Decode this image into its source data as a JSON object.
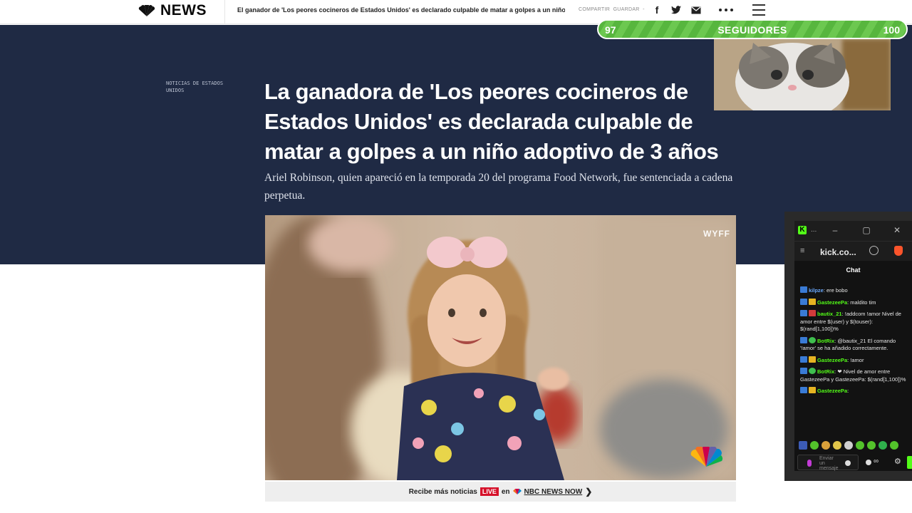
{
  "topbar": {
    "logo_text": "NEWS",
    "headline": "El ganador de 'Los peores cocineros de Estados Unidos' es declarado culpable de matar a golpes a un niño",
    "share_label": "COMPARTIR",
    "save_label": "GUARDAR",
    "more_icon": "more-dots-icon",
    "icons": [
      "facebook-icon",
      "twitter-icon",
      "email-icon",
      "menu-icon"
    ]
  },
  "article": {
    "category": "NOTICIAS DE ESTADOS UNIDOS",
    "title": "La ganadora de 'Los peores cocineros de Estados Unidos' es declarada culpable de matar a golpes a un niño adoptivo de 3 años",
    "dek": "Ariel Robinson, quien apareció en la temporada 20 del programa Food Network, fue sentenciada a cadena perpetua.",
    "video_watermark": "WYFF",
    "promo_prefix": "Recibe más noticias",
    "promo_live": "LIVE",
    "promo_en": "en",
    "promo_brand": "NBC NEWS NOW"
  },
  "overlay": {
    "followers_current": "97",
    "followers_label": "SEGUIDORES",
    "followers_goal": "100",
    "followers_progress": 0.97
  },
  "chat": {
    "url": "kick.co...",
    "header": "Chat",
    "messages": [
      {
        "user": "kilpze",
        "user_color": "#6aa9ff",
        "badges": [
          "b-blue"
        ],
        "text": ": ere bobo"
      },
      {
        "user": "GastezeePa",
        "user_color": "#53fc18",
        "badges": [
          "b-blue",
          "b-gold"
        ],
        "text": ": maldito tim"
      },
      {
        "user": "bautix_21",
        "user_color": "#53fc18",
        "badges": [
          "b-blue",
          "b-red"
        ],
        "text": ": !addcom !amor Nivel de amor entre $(user) y $(touser): $(rand[1,100])%"
      },
      {
        "user": "BotRix",
        "user_color": "#53fc18",
        "badges": [
          "b-blue",
          "b-green"
        ],
        "text": ": @bautix_21 El comando '!amor' se ha añadido correctamente."
      },
      {
        "user": "GastezeePa",
        "user_color": "#53fc18",
        "badges": [
          "b-blue",
          "b-gold"
        ],
        "text": ": !amor"
      },
      {
        "user": "BotRix",
        "user_color": "#53fc18",
        "badges": [
          "b-blue",
          "b-green"
        ],
        "text": ": ❤ Nivel de amor entre GastezeePa y GastezeePa: $(rand[1,100])%"
      },
      {
        "user": "GastezeePa",
        "user_color": "#53fc18",
        "badges": [
          "b-blue",
          "b-gold"
        ],
        "text": ":"
      }
    ],
    "input_placeholder": "Enviar un mensaje",
    "colors": {
      "accent": "#53fc18",
      "bg": "#121212"
    }
  }
}
